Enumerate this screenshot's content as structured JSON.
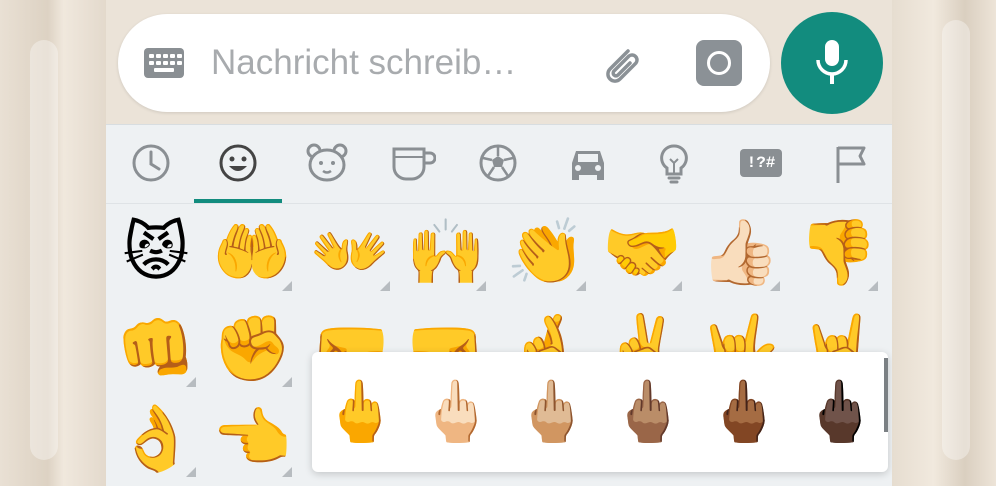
{
  "composer": {
    "placeholder": "Nachricht schreib…",
    "keyboard_icon": "keyboard-icon",
    "attach_icon": "paperclip-icon",
    "camera_icon": "camera-icon"
  },
  "mic_button": {
    "icon": "microphone-icon",
    "color": "#128c7e"
  },
  "emoji_tabs": {
    "items": [
      {
        "icon": "recent-clock-icon"
      },
      {
        "icon": "smiley-icon",
        "active": true
      },
      {
        "icon": "animal-bear-icon"
      },
      {
        "icon": "food-cup-icon"
      },
      {
        "icon": "soccer-ball-icon"
      },
      {
        "icon": "car-icon"
      },
      {
        "icon": "lightbulb-icon"
      },
      {
        "icon": "symbols-icon",
        "text": "!?#"
      },
      {
        "icon": "flag-icon"
      }
    ],
    "accent": "#128c7e"
  },
  "emoji_grid": {
    "row1": [
      "😾",
      "🤲",
      "👐",
      "🙌",
      "👏",
      "🤝",
      "👍🏻",
      "👎"
    ],
    "row2": [
      "👊",
      "✊",
      "🤛",
      "🤜",
      "🤞",
      "✌️",
      "🤟",
      "🤘"
    ],
    "row3": [
      "👌",
      "👈"
    ]
  },
  "skin_tone_popup": {
    "options": [
      "🖕",
      "🖕🏻",
      "🖕🏼",
      "🖕🏽",
      "🖕🏾",
      "🖕🏿"
    ]
  }
}
